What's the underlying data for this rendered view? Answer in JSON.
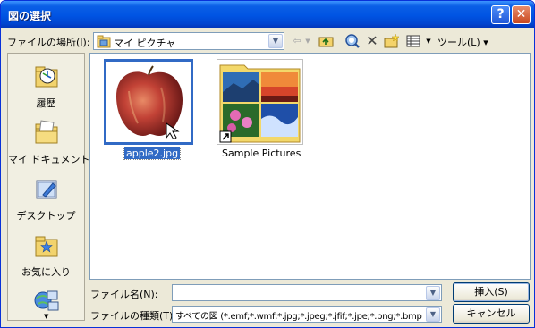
{
  "window": {
    "title": "図の選択"
  },
  "title_buttons": {
    "help": "?",
    "close": "✕"
  },
  "lookin": {
    "label": "ファイルの場所(I):",
    "value": "マイ ピクチャ"
  },
  "toolbar": {
    "tools_label": "ツール(L) ▾"
  },
  "places": [
    {
      "label": "履歴",
      "icon": "history-icon"
    },
    {
      "label": "マイ ドキュメント",
      "icon": "my-documents-icon"
    },
    {
      "label": "デスクトップ",
      "icon": "desktop-icon"
    },
    {
      "label": "お気に入り",
      "icon": "favorites-icon"
    }
  ],
  "files": [
    {
      "name": "apple2.jpg",
      "type": "image",
      "selected": true
    },
    {
      "name": "Sample Pictures",
      "type": "folder-shortcut",
      "selected": false
    }
  ],
  "filename": {
    "label": "ファイル名(N):",
    "value": ""
  },
  "filetype": {
    "label": "ファイルの種類(T):",
    "value": "すべての図 (*.emf;*.wmf;*.jpg;*.jpeg;*.jfif;*.jpe;*.png;*.bmp"
  },
  "buttons": {
    "insert": "挿入(S)",
    "cancel": "キャンセル"
  },
  "colors": {
    "titlebar": "#0054e3",
    "selection": "#316ac5",
    "dialog_bg": "#ece9d8"
  }
}
